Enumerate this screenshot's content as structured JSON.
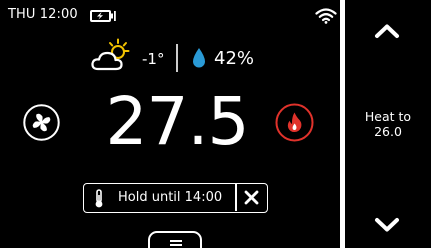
{
  "status": {
    "time": "THU 12:00",
    "battery_icon": "battery-charging-icon",
    "wifi_icon": "wifi-icon"
  },
  "weather": {
    "icon": "partly-sunny-icon",
    "outdoor_temp": "-1°",
    "humidity_icon": "water-drop-icon",
    "humidity": "42%"
  },
  "main": {
    "temperature": "27.5",
    "fan_icon": "fan-icon",
    "mode_icon": "flame-icon"
  },
  "hold": {
    "icon": "thermometer-icon",
    "label": "Hold until 14:00",
    "close_icon": "close-icon"
  },
  "setpoint": {
    "line1": "Heat to",
    "line2": "26.0",
    "up_icon": "chevron-up-icon",
    "down_icon": "chevron-down-icon"
  },
  "menu": {
    "icon": "menu-icon"
  },
  "colors": {
    "background": "#000000",
    "foreground": "#ffffff",
    "heat": "#e0322b",
    "humidity": "#2a9ad6",
    "sun": "#f2c200"
  }
}
